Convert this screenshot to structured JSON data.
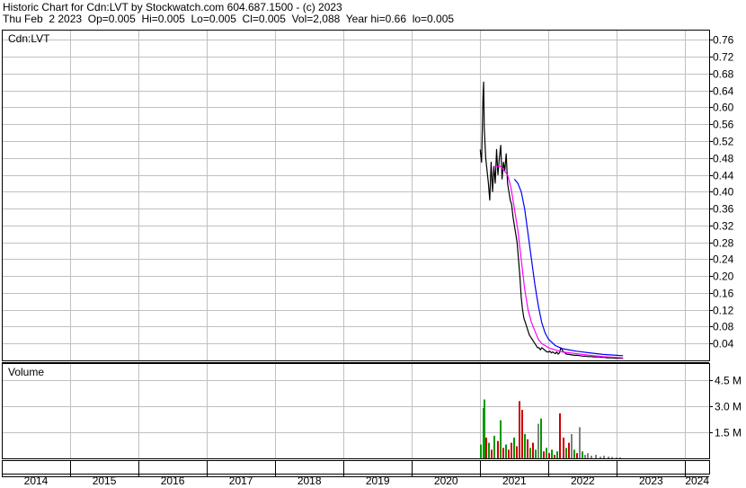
{
  "header": {
    "line1": "Historic Chart for Cdn:LVT by Stockwatch.com 604.687.1500 - (c) 2023",
    "line2": "Thu Feb  2 2023  Op=0.005  Hi=0.005  Lo=0.005  Cl=0.005  Vol=2,088  Year hi=0.66  lo=0.005"
  },
  "colors": {
    "price": "#000000",
    "ma_short": "#ff00ff",
    "ma_long": "#0000ff",
    "vol_up": "#009900",
    "vol_down": "#cc0000",
    "vol_flat": "#808080",
    "grid": "#c0c0c0"
  },
  "chart_data": [
    {
      "type": "line",
      "title": "Cdn:LVT",
      "ylim": [
        0,
        0.78
      ],
      "yticks": [
        "0.04",
        "0.08",
        "0.12",
        "0.16",
        "0.20",
        "0.24",
        "0.28",
        "0.32",
        "0.36",
        "0.40",
        "0.44",
        "0.48",
        "0.52",
        "0.56",
        "0.60",
        "0.64",
        "0.68",
        "0.72",
        "0.76"
      ],
      "xlim": [
        2014.0,
        2024.35
      ],
      "grid": true,
      "series": [
        {
          "role": "price",
          "x": [
            2021.0,
            2021.02,
            2021.04,
            2021.05,
            2021.06,
            2021.08,
            2021.1,
            2021.12,
            2021.14,
            2021.16,
            2021.18,
            2021.2,
            2021.22,
            2021.24,
            2021.26,
            2021.28,
            2021.3,
            2021.32,
            2021.34,
            2021.36,
            2021.38,
            2021.4,
            2021.42,
            2021.44,
            2021.46,
            2021.48,
            2021.5,
            2021.52,
            2021.54,
            2021.56,
            2021.58,
            2021.6,
            2021.62,
            2021.64,
            2021.66,
            2021.68,
            2021.7,
            2021.72,
            2021.74,
            2021.76,
            2021.78,
            2021.8,
            2021.82,
            2021.84,
            2021.86,
            2021.88,
            2021.9,
            2021.92,
            2021.94,
            2021.96,
            2021.98,
            2022.0,
            2022.02,
            2022.04,
            2022.06,
            2022.08,
            2022.1,
            2022.12,
            2022.14,
            2022.16,
            2022.18,
            2022.2,
            2022.22,
            2022.24,
            2022.26,
            2022.3,
            2022.34,
            2022.38,
            2022.42,
            2022.46,
            2022.5,
            2022.54,
            2022.58,
            2022.62,
            2022.66,
            2022.7,
            2022.74,
            2022.78,
            2022.82,
            2022.86,
            2022.9,
            2022.94,
            2022.98,
            2023.02,
            2023.06,
            2023.09
          ],
          "values": [
            0.5,
            0.47,
            0.62,
            0.66,
            0.55,
            0.48,
            0.45,
            0.42,
            0.38,
            0.47,
            0.4,
            0.46,
            0.42,
            0.5,
            0.44,
            0.48,
            0.51,
            0.43,
            0.47,
            0.45,
            0.49,
            0.42,
            0.4,
            0.38,
            0.37,
            0.34,
            0.32,
            0.3,
            0.28,
            0.24,
            0.2,
            0.15,
            0.12,
            0.1,
            0.09,
            0.08,
            0.07,
            0.06,
            0.055,
            0.05,
            0.045,
            0.04,
            0.035,
            0.03,
            0.03,
            0.025,
            0.03,
            0.028,
            0.025,
            0.022,
            0.02,
            0.02,
            0.022,
            0.018,
            0.02,
            0.018,
            0.016,
            0.02,
            0.015,
            0.018,
            0.03,
            0.025,
            0.02,
            0.018,
            0.015,
            0.014,
            0.013,
            0.012,
            0.012,
            0.011,
            0.01,
            0.01,
            0.009,
            0.009,
            0.008,
            0.008,
            0.008,
            0.007,
            0.007,
            0.006,
            0.006,
            0.006,
            0.005,
            0.005,
            0.005,
            0.005
          ]
        },
        {
          "role": "moving-average-short",
          "x": [
            2021.2,
            2021.3,
            2021.4,
            2021.45,
            2021.5,
            2021.55,
            2021.6,
            2021.65,
            2021.7,
            2021.75,
            2021.8,
            2021.85,
            2021.9,
            2022.0,
            2022.1,
            2022.2,
            2022.4,
            2022.6,
            2022.8,
            2023.0,
            2023.09
          ],
          "values": [
            0.46,
            0.46,
            0.44,
            0.41,
            0.36,
            0.31,
            0.24,
            0.17,
            0.12,
            0.09,
            0.07,
            0.05,
            0.04,
            0.03,
            0.025,
            0.02,
            0.016,
            0.012,
            0.009,
            0.007,
            0.006
          ]
        },
        {
          "role": "moving-average-long",
          "x": [
            2021.5,
            2021.55,
            2021.6,
            2021.65,
            2021.7,
            2021.75,
            2021.8,
            2021.85,
            2021.9,
            2021.95,
            2022.0,
            2022.1,
            2022.2,
            2022.4,
            2022.6,
            2022.8,
            2023.0,
            2023.09
          ],
          "values": [
            0.43,
            0.42,
            0.4,
            0.36,
            0.3,
            0.24,
            0.18,
            0.13,
            0.09,
            0.065,
            0.05,
            0.035,
            0.028,
            0.022,
            0.018,
            0.014,
            0.012,
            0.011
          ]
        }
      ]
    },
    {
      "type": "bar",
      "title": "Volume",
      "ylim": [
        0,
        5.5
      ],
      "yticks": [
        "1.5 M",
        "3.0 M",
        "4.5 M"
      ],
      "bars": [
        {
          "x": 2021.0,
          "v": 0.8,
          "dir": "up"
        },
        {
          "x": 2021.03,
          "v": 2.9,
          "dir": "up"
        },
        {
          "x": 2021.05,
          "v": 3.4,
          "dir": "up"
        },
        {
          "x": 2021.08,
          "v": 1.2,
          "dir": "down"
        },
        {
          "x": 2021.12,
          "v": 0.9,
          "dir": "up"
        },
        {
          "x": 2021.16,
          "v": 0.5,
          "dir": "down"
        },
        {
          "x": 2021.2,
          "v": 1.3,
          "dir": "up"
        },
        {
          "x": 2021.24,
          "v": 1.0,
          "dir": "down"
        },
        {
          "x": 2021.28,
          "v": 2.2,
          "dir": "up"
        },
        {
          "x": 2021.32,
          "v": 0.6,
          "dir": "down"
        },
        {
          "x": 2021.36,
          "v": 0.8,
          "dir": "up"
        },
        {
          "x": 2021.4,
          "v": 0.5,
          "dir": "down"
        },
        {
          "x": 2021.44,
          "v": 0.9,
          "dir": "down"
        },
        {
          "x": 2021.48,
          "v": 1.2,
          "dir": "up"
        },
        {
          "x": 2021.52,
          "v": 0.7,
          "dir": "down"
        },
        {
          "x": 2021.56,
          "v": 3.3,
          "dir": "down"
        },
        {
          "x": 2021.6,
          "v": 2.8,
          "dir": "down"
        },
        {
          "x": 2021.64,
          "v": 1.4,
          "dir": "up"
        },
        {
          "x": 2021.68,
          "v": 1.1,
          "dir": "down"
        },
        {
          "x": 2021.72,
          "v": 0.6,
          "dir": "up"
        },
        {
          "x": 2021.76,
          "v": 0.9,
          "dir": "down"
        },
        {
          "x": 2021.8,
          "v": 0.5,
          "dir": "up"
        },
        {
          "x": 2021.84,
          "v": 2.0,
          "dir": "flat"
        },
        {
          "x": 2021.88,
          "v": 2.3,
          "dir": "up"
        },
        {
          "x": 2021.92,
          "v": 0.4,
          "dir": "down"
        },
        {
          "x": 2021.96,
          "v": 0.6,
          "dir": "up"
        },
        {
          "x": 2022.0,
          "v": 0.3,
          "dir": "down"
        },
        {
          "x": 2022.04,
          "v": 0.5,
          "dir": "up"
        },
        {
          "x": 2022.08,
          "v": 0.2,
          "dir": "down"
        },
        {
          "x": 2022.12,
          "v": 0.4,
          "dir": "up"
        },
        {
          "x": 2022.16,
          "v": 2.6,
          "dir": "down"
        },
        {
          "x": 2022.2,
          "v": 1.2,
          "dir": "down"
        },
        {
          "x": 2022.24,
          "v": 0.6,
          "dir": "up"
        },
        {
          "x": 2022.28,
          "v": 0.9,
          "dir": "down"
        },
        {
          "x": 2022.32,
          "v": 1.4,
          "dir": "flat"
        },
        {
          "x": 2022.36,
          "v": 0.5,
          "dir": "up"
        },
        {
          "x": 2022.4,
          "v": 0.3,
          "dir": "down"
        },
        {
          "x": 2022.44,
          "v": 1.8,
          "dir": "flat"
        },
        {
          "x": 2022.48,
          "v": 0.4,
          "dir": "up"
        },
        {
          "x": 2022.52,
          "v": 0.2,
          "dir": "flat"
        },
        {
          "x": 2022.56,
          "v": 0.3,
          "dir": "flat"
        },
        {
          "x": 2022.62,
          "v": 0.15,
          "dir": "flat"
        },
        {
          "x": 2022.68,
          "v": 0.2,
          "dir": "flat"
        },
        {
          "x": 2022.74,
          "v": 0.1,
          "dir": "flat"
        },
        {
          "x": 2022.8,
          "v": 0.15,
          "dir": "flat"
        },
        {
          "x": 2022.86,
          "v": 0.1,
          "dir": "flat"
        },
        {
          "x": 2022.92,
          "v": 0.08,
          "dir": "flat"
        },
        {
          "x": 2022.98,
          "v": 0.05,
          "dir": "flat"
        },
        {
          "x": 2023.04,
          "v": 0.05,
          "dir": "flat"
        }
      ]
    },
    {
      "type": "axis",
      "xticks": [
        {
          "label": "2014",
          "start": 2014.0,
          "end": 2015.0
        },
        {
          "label": "2015",
          "start": 2015.0,
          "end": 2016.0
        },
        {
          "label": "2016",
          "start": 2016.0,
          "end": 2017.0
        },
        {
          "label": "2017",
          "start": 2017.0,
          "end": 2018.0
        },
        {
          "label": "2018",
          "start": 2018.0,
          "end": 2019.0
        },
        {
          "label": "2019",
          "start": 2019.0,
          "end": 2020.0
        },
        {
          "label": "2020",
          "start": 2020.0,
          "end": 2021.0
        },
        {
          "label": "2021",
          "start": 2021.0,
          "end": 2022.0
        },
        {
          "label": "2022",
          "start": 2022.0,
          "end": 2023.0
        },
        {
          "label": "2023",
          "start": 2023.0,
          "end": 2024.0
        },
        {
          "label": "2024",
          "start": 2024.0,
          "end": 2024.35
        }
      ]
    }
  ]
}
